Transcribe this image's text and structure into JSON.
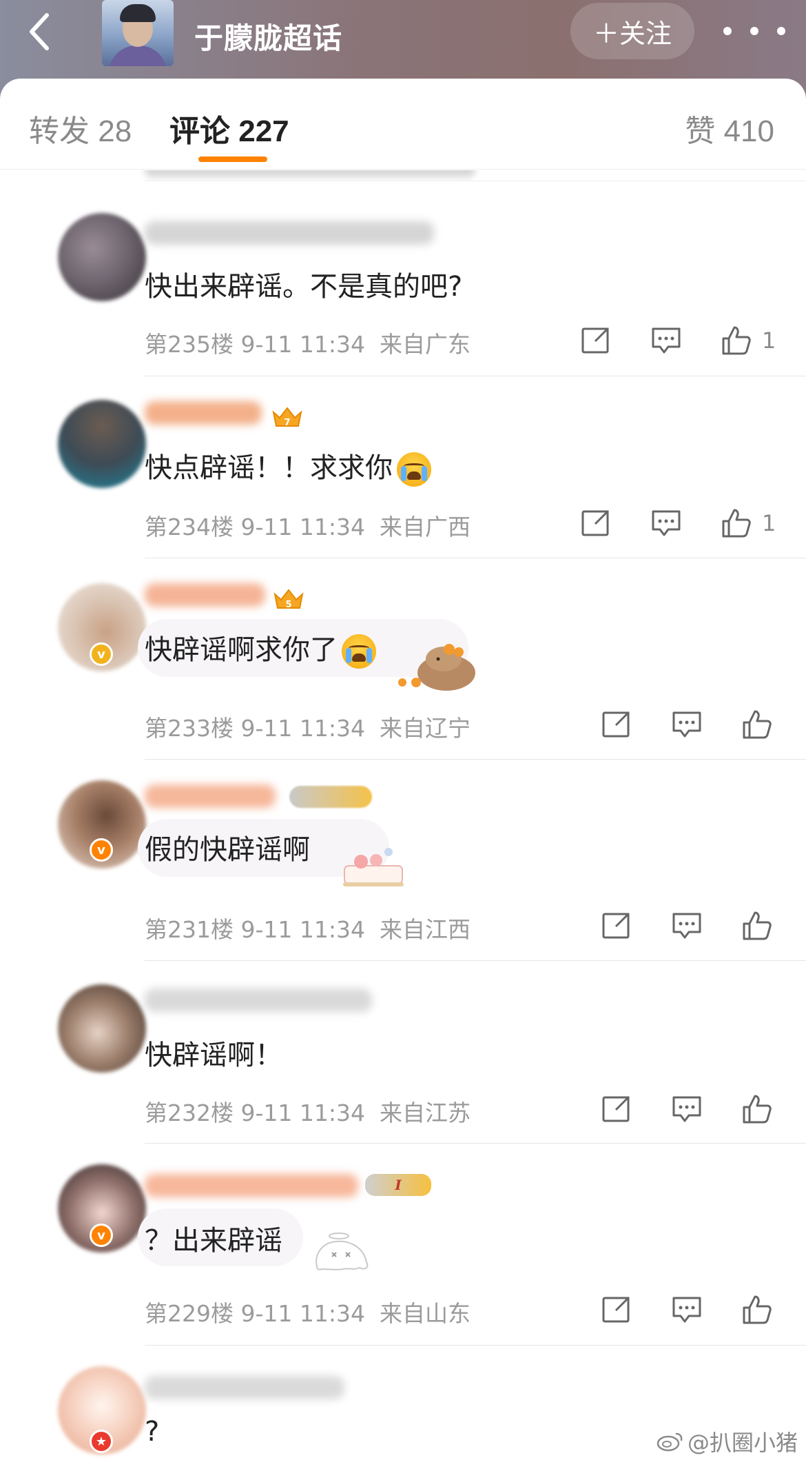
{
  "header": {
    "super_topic_title": "于朦胧超话",
    "follow_label": "＋关注"
  },
  "tabs": [
    {
      "label": "转发",
      "count": "28"
    },
    {
      "label": "评论",
      "count": "227"
    },
    {
      "label": "赞",
      "count": "410"
    }
  ],
  "comments": [
    {
      "text": "快出来辟谣。不是真的吧?",
      "floor": "第235楼",
      "time": "9-11 11:34",
      "location": "来自广东",
      "likes": "1"
    },
    {
      "text": "快点辟谣！！求求你",
      "floor": "第234楼",
      "time": "9-11 11:34",
      "location": "来自广西",
      "likes": "1",
      "member_level": "7"
    },
    {
      "text": "快辟谣啊求你了",
      "floor": "第233楼",
      "time": "9-11 11:34",
      "location": "来自辽宁",
      "likes": "",
      "member_level": "5"
    },
    {
      "text": "假的快辟谣啊",
      "floor": "第231楼",
      "time": "9-11 11:34",
      "location": "来自江西",
      "likes": ""
    },
    {
      "text": "快辟谣啊！",
      "floor": "第232楼",
      "time": "9-11 11:34",
      "location": "来自江苏",
      "likes": ""
    },
    {
      "text": "？出来辟谣",
      "floor": "第229楼",
      "time": "9-11 11:34",
      "location": "来自山东",
      "likes": "",
      "member_level": "I"
    },
    {
      "text": "?",
      "floor": "",
      "time": "",
      "location": "",
      "likes": ""
    }
  ],
  "watermark": "@扒圈小猪",
  "colors": {
    "accent": "#ff8200",
    "verified_gold": "#f2b21c",
    "verified_orange": "#ff8200",
    "verified_red": "#ea3a2e"
  },
  "icons": {
    "back": "chevron-left-icon",
    "repost": "share-box-icon",
    "comment": "chat-bubble-icon",
    "like": "thumbs-up-icon",
    "more": "ellipsis-icon"
  }
}
